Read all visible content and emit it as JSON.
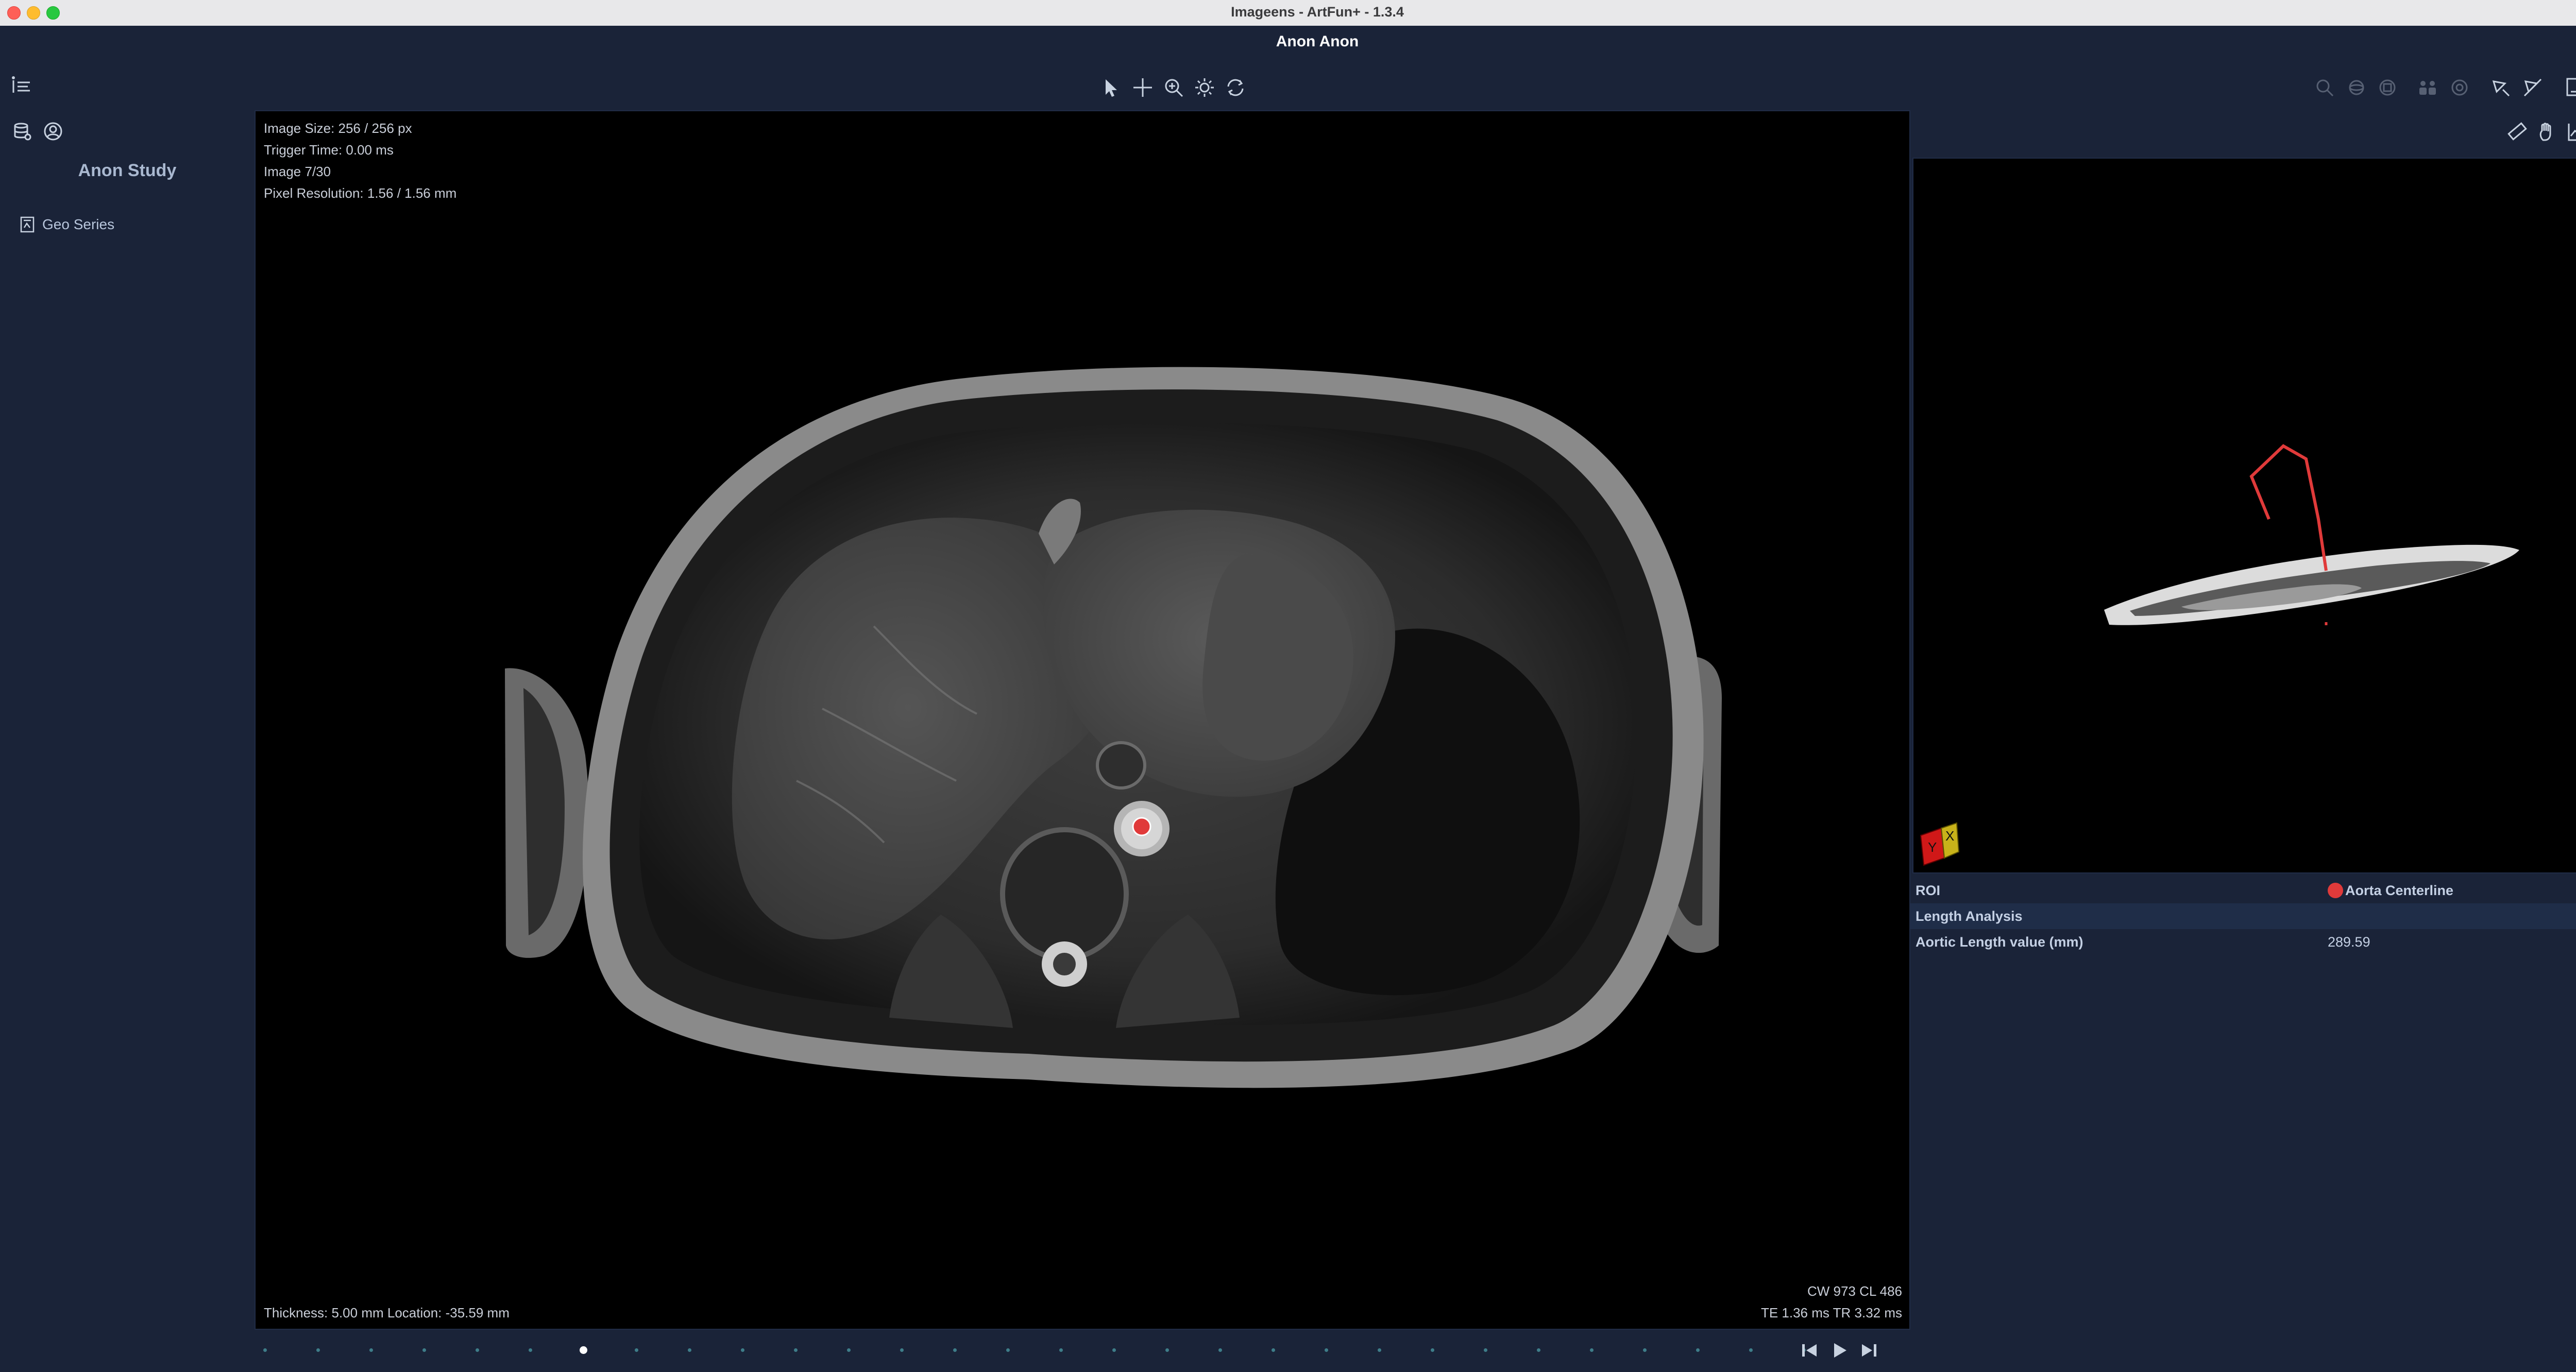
{
  "window": {
    "title": "Imageens - ArtFun+ - 1.3.4"
  },
  "patient": {
    "name": "Anon Anon"
  },
  "toolbar": {
    "tools": [
      "pointer-icon",
      "crosshair-icon",
      "zoom-icon",
      "brightness-icon",
      "reset-rotate-icon"
    ],
    "right_tools": [
      "magnify-icon",
      "rotate-3d-icon",
      "rotate-cube-icon",
      "group-icon",
      "target-circle-icon",
      "roi-draw-icon",
      "roi-delete-icon",
      "export-icon",
      "save-icon"
    ]
  },
  "sidebar": {
    "icons": [
      "database-icon",
      "user-circle-icon"
    ],
    "study_title": "Anon Study",
    "series": [
      {
        "label": "Geo Series"
      }
    ]
  },
  "viewer": {
    "overlay_top_left": [
      "Image Size: 256 / 256 px",
      "Trigger Time: 0.00 ms",
      "Image 7/30",
      "Pixel Resolution: 1.56 / 1.56 mm"
    ],
    "overlay_bottom_left": "Thickness: 5.00 mm Location: -35.59 mm",
    "overlay_bottom_right": [
      "CW 973 CL 486",
      "TE 1.36 ms TR 3.32 ms"
    ],
    "roi_point_color": "#e03a3a"
  },
  "timeline": {
    "total_frames": 30,
    "current_frame": 7
  },
  "playback": [
    "step-back-icon",
    "play-icon",
    "step-forward-icon"
  ],
  "right_panel": {
    "toolbar": [
      "ruler-icon",
      "hand-icon",
      "chart-line-icon",
      "chart-area-icon"
    ],
    "orientation_cube": {
      "labels": [
        "Y",
        "X"
      ]
    },
    "properties": [
      {
        "key": "ROI",
        "value": "Aorta Centerline",
        "type": "roi",
        "color": "#e03a3a"
      },
      {
        "key": "Length Analysis",
        "value": "",
        "type": "section"
      },
      {
        "key": "Aortic Length value (mm)",
        "value": "289.59",
        "type": "value"
      }
    ]
  },
  "colors": {
    "background": "#1a2338",
    "viewer_bg": "#000000",
    "accent_teal": "#3e7d89",
    "roi_red": "#e03a3a",
    "text": "#c8d2e0"
  }
}
